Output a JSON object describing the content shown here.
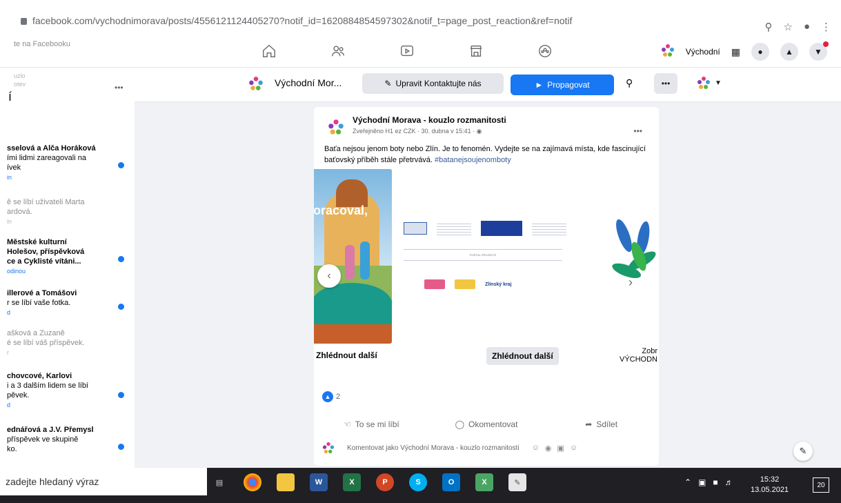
{
  "browser": {
    "url": "facebook.com/vychodnimorava/posts/4556121124405270?notif_id=1620884854597302&notif_t=page_post_reaction&ref=notif"
  },
  "topbar": {
    "left_text": "te na Facebooku",
    "page_name": "Východní"
  },
  "sidebar": {
    "top_small_1": "uzlo",
    "top_small_2": "otev",
    "letter": "í",
    "notifications": [
      {
        "line1": "sselová a Alča Horáková",
        "line2": "ími lidmi zareagovali na",
        "line3": "ívek",
        "sub": "in",
        "unread": true
      },
      {
        "line1": "ě se líbí uživateli Marta",
        "line2": "ardová.",
        "line3": "",
        "sub": "in",
        "unread": false
      },
      {
        "line1": "Městské kulturní",
        "line2": "Holešov, příspěvková",
        "line3": "ce a Cyklisté vítáni...",
        "sub": "odinou",
        "unread": true
      },
      {
        "line1": "illerové a Tomášovi",
        "line2": "r se líbí vaše fotka.",
        "line3": "",
        "sub": "d",
        "unread": true
      },
      {
        "line1": "ašková a Zuzaně",
        "line2": "é se líbí váš příspěvek.",
        "line3": "",
        "sub": "r",
        "unread": false
      },
      {
        "line1": "chovcové, Karlovi",
        "line2": "i a 3 dalším lidem se líbí",
        "line3": "pěvek.",
        "sub": "d",
        "unread": true
      },
      {
        "line1": "ednářová a J.V. Přemysl",
        "line2": "příspěvek ve skupině",
        "line3": "ko.",
        "sub": "",
        "unread": true
      }
    ]
  },
  "page_header": {
    "name": "Východní Mor...",
    "edit_label": "Upravit Kontaktujte nás",
    "promote_label": "Propagovat"
  },
  "post": {
    "author": "Východní Morava - kouzlo rozmanitosti",
    "meta": "Zveřejněno H1 ez CZK · 30. dubna v 15:41 ·",
    "text": "Baťa nejsou jenom boty nebo Zlín. Je to fenomén. Vydejte se na zajímavá místa, kde fascinující baťovský příběh stále přetrvává.",
    "hashtag": "#batanejsoujenomboty",
    "card1_text": "oracoval,",
    "card2_title": "PORTÁL PROJEKTŮ",
    "card2_zlin": "Zlínský kraj",
    "cta1": "Zhlédnout další",
    "cta2": "Zhlédnout další",
    "cta3_line1": "Zobr",
    "cta3_line2": "VÝCHODN",
    "reaction_count": "2",
    "like_label": "To se mi líbí",
    "comment_label": "Okomentovat",
    "share_label": "Sdílet",
    "comment_placeholder": "Komentovat jako Východní Morava - kouzlo rozmanitosti"
  },
  "taskbar": {
    "search_placeholder": "zadejte hledaný výraz",
    "time": "15:32",
    "date": "13.05.2021",
    "notif_count": "20"
  },
  "colors": {
    "fb_blue": "#1877f2",
    "taskbar": "#1f1f24"
  }
}
